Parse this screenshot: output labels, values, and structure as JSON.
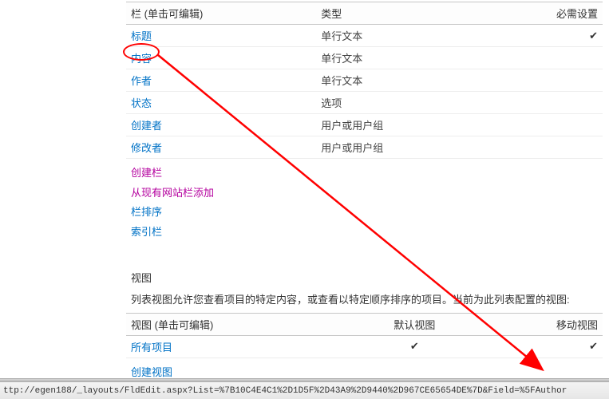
{
  "columns_table": {
    "headers": {
      "col": "栏 (单击可编辑)",
      "type": "类型",
      "required": "必需设置"
    },
    "rows": [
      {
        "name": "标题",
        "type": "单行文本",
        "required": "✔"
      },
      {
        "name": "内容",
        "type": "单行文本",
        "required": ""
      },
      {
        "name": "作者",
        "type": "单行文本",
        "required": ""
      },
      {
        "name": "状态",
        "type": "选项",
        "required": ""
      },
      {
        "name": "创建者",
        "type": "用户或用户组",
        "required": ""
      },
      {
        "name": "修改者",
        "type": "用户或用户组",
        "required": ""
      }
    ]
  },
  "actions": {
    "create_column": "创建栏",
    "add_from_site": "从现有网站栏添加",
    "column_order": "栏排序",
    "index_column": "索引栏"
  },
  "views": {
    "heading": "视图",
    "description": "列表视图允许您查看项目的特定内容，或查看以特定顺序排序的项目。当前为此列表配置的视图:",
    "headers": {
      "view": "视图 (单击可编辑)",
      "default": "默认视图",
      "mobile": "移动视图"
    },
    "rows": [
      {
        "name": "所有项目",
        "default": "✔",
        "mobile": "✔"
      }
    ],
    "create_view": "创建视图"
  },
  "status_bar": {
    "url": "ttp://egen188/_layouts/FldEdit.aspx?List=%7B10C4E4C1%2D1D5F%2D43A9%2D9440%2D967CE65654DE%7D&Field=%5FAuthor"
  }
}
